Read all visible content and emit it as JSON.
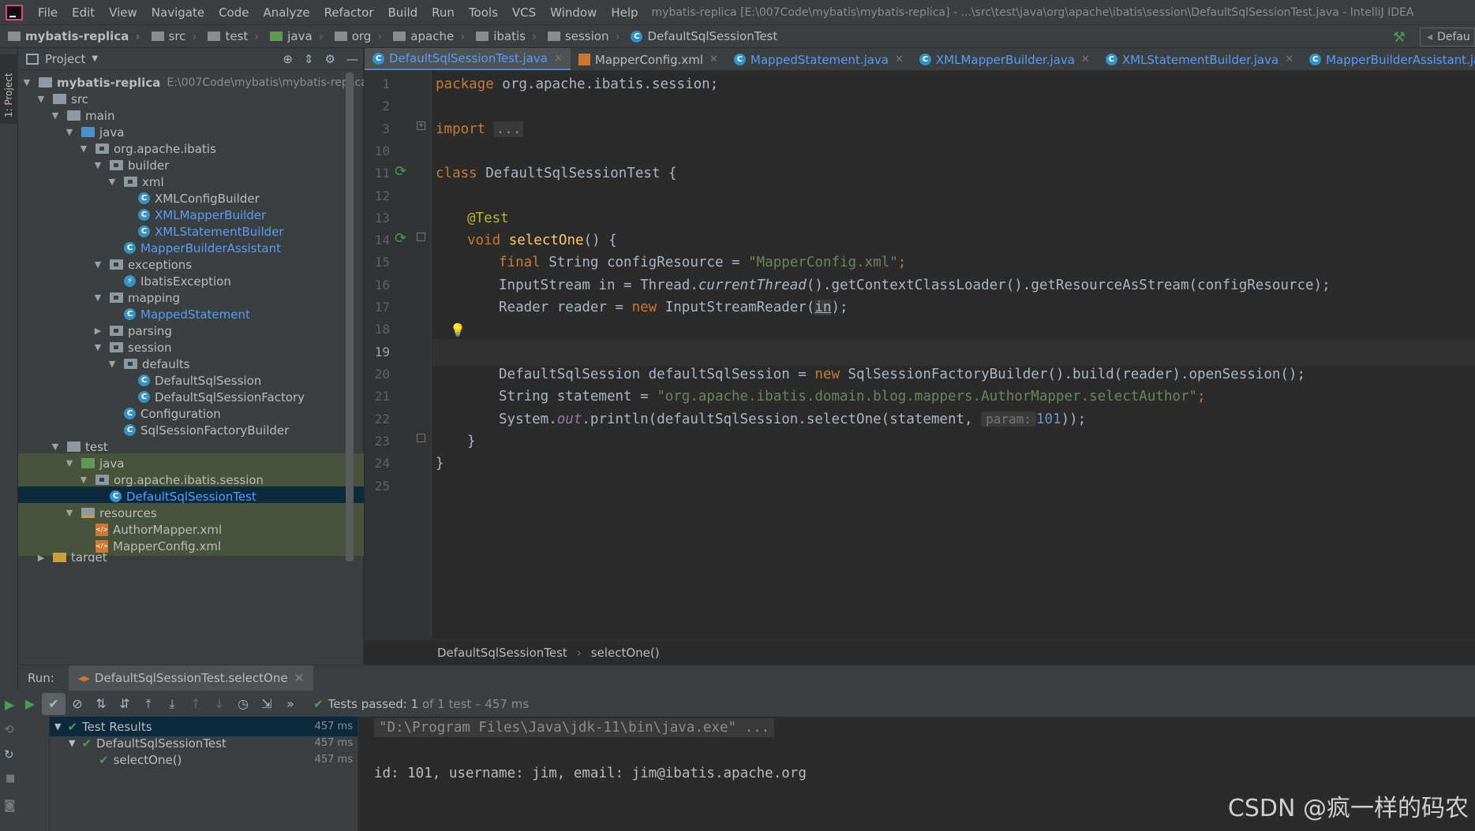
{
  "menu": [
    "File",
    "Edit",
    "View",
    "Navigate",
    "Code",
    "Analyze",
    "Refactor",
    "Build",
    "Run",
    "Tools",
    "VCS",
    "Window",
    "Help"
  ],
  "window_title": "mybatis-replica [E:\\007Code\\mybatis\\mybatis-replica] - ...\\src\\test\\java\\org\\apache\\ibatis\\session\\DefaultSqlSessionTest.java - IntelliJ IDEA",
  "breadcrumbs": [
    "mybatis-replica",
    "src",
    "test",
    "java",
    "org",
    "apache",
    "ibatis",
    "session",
    "DefaultSqlSessionTest"
  ],
  "run_config": "Defau",
  "left_stripe_tab": "1: Project",
  "project_panel": {
    "title": "Project"
  },
  "tree": [
    {
      "label": "mybatis-replica",
      "path": "E:\\007Code\\mybatis\\mybatis-replica"
    },
    {
      "label": "src"
    },
    {
      "label": "main"
    },
    {
      "label": "java"
    },
    {
      "label": "org.apache.ibatis"
    },
    {
      "label": "builder"
    },
    {
      "label": "xml"
    },
    {
      "label": "XMLConfigBuilder"
    },
    {
      "label": "XMLMapperBuilder"
    },
    {
      "label": "XMLStatementBuilder"
    },
    {
      "label": "MapperBuilderAssistant"
    },
    {
      "label": "exceptions"
    },
    {
      "label": "IbatisException"
    },
    {
      "label": "mapping"
    },
    {
      "label": "MappedStatement"
    },
    {
      "label": "parsing"
    },
    {
      "label": "session"
    },
    {
      "label": "defaults"
    },
    {
      "label": "DefaultSqlSession"
    },
    {
      "label": "DefaultSqlSessionFactory"
    },
    {
      "label": "Configuration"
    },
    {
      "label": "SqlSessionFactoryBuilder"
    },
    {
      "label": "test"
    },
    {
      "label": "java"
    },
    {
      "label": "org.apache.ibatis.session"
    },
    {
      "label": "DefaultSqlSessionTest"
    },
    {
      "label": "resources"
    },
    {
      "label": "AuthorMapper.xml"
    },
    {
      "label": "MapperConfig.xml"
    },
    {
      "label": "target"
    }
  ],
  "editor_tabs": [
    "DefaultSqlSessionTest.java",
    "MapperConfig.xml",
    "MappedStatement.java",
    "XMLMapperBuilder.java",
    "XMLStatementBuilder.java",
    "MapperBuilderAssistant.java"
  ],
  "line_numbers": [
    "1",
    "2",
    "3",
    "10",
    "11",
    "12",
    "13",
    "14",
    "15",
    "16",
    "17",
    "18",
    "19",
    "20",
    "21",
    "22",
    "23",
    "24",
    "25"
  ],
  "code": {
    "l1_kw": "package",
    "l1_rest": " org.apache.ibatis.session;",
    "l3_kw": "import",
    "l3_fold": "...",
    "l11_kw": "class",
    "l11_rest": " DefaultSqlSessionTest {",
    "l13": "@Test",
    "l14_kw": "void",
    "l14_fn": "selectOne",
    "l14_rest": "() {",
    "l15_kw": "final",
    "l15_a": " String configResource = ",
    "l15_str": "\"MapperConfig.xml\"",
    "l15_end": ";",
    "l16_a": "InputStream in = Thread.",
    "l16_it": "currentThread",
    "l16_b": "().getContextClassLoader().getResourceAsStream(configResource);",
    "l17_a": "Reader reader = ",
    "l17_kw": "new",
    "l17_b": " InputStreamReader(",
    "l17_c": "in",
    "l17_d": ");",
    "l20_a": "DefaultSqlSession defaultSqlSession = ",
    "l20_kw": "new",
    "l20_b": " SqlSessionFactoryBuilder().build(reader).openSession();",
    "l21_a": "String statement = ",
    "l21_str": "\"org.apache.ibatis.domain.blog.mappers.AuthorMapper.selectAuthor\"",
    "l21_end": ";",
    "l22_a": "System.",
    "l22_field": "out",
    "l22_b": ".println(defaultSqlSession.selectOne(statement, ",
    "l22_hint": "param:",
    "l22_num": "101",
    "l22_end": "));",
    "l23": "}",
    "l24": "}"
  },
  "editor_breadcrumb": [
    "DefaultSqlSessionTest",
    "selectOne()"
  ],
  "run": {
    "label": "Run:",
    "tab": "DefaultSqlSessionTest.selectOne",
    "status_prefix": "Tests passed: ",
    "status_count": "1",
    "status_rest": " of 1 test – 457 ms",
    "results": [
      {
        "label": "Test Results",
        "time": "457 ms"
      },
      {
        "label": "DefaultSqlSessionTest",
        "time": "457 ms"
      },
      {
        "label": "selectOne()",
        "time": "457 ms"
      }
    ],
    "console": [
      "\"D:\\Program Files\\Java\\jdk-11\\bin\\java.exe\" ...",
      "id: 101, username: jim, email: jim@ibatis.apache.org"
    ]
  },
  "watermark": "CSDN @疯一样的码农",
  "colors": {
    "keyword": "#cc7832",
    "string": "#6a8759",
    "annotation": "#bbb529",
    "function": "#ffc66d",
    "number": "#6897bb",
    "pass": "#499c54",
    "link": "#589df6"
  }
}
